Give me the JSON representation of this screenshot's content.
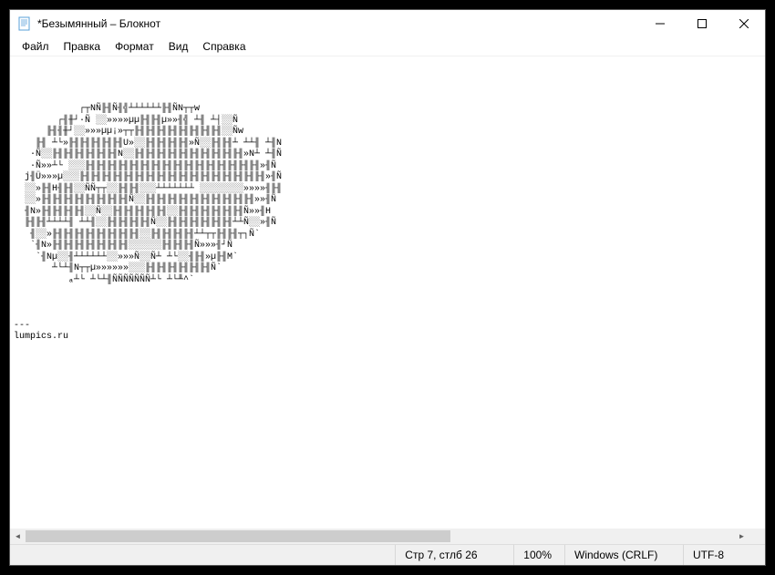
{
  "window": {
    "title": "*Безымянный – Блокнот"
  },
  "menu": {
    "file": "Файл",
    "edit": "Правка",
    "format": "Формат",
    "view": "Вид",
    "help": "Справка"
  },
  "content": {
    "text": "\n\n\n\n            ┌┬NÑ╟╢Ñ╢╣┴┴┴┴┴┴╟╢ÑN┬┬w\n        ┌╢╫┘·Ñ ░░»»»»µµ╟╢╟╢µ»»╢╣ ┴╢ ┴┤░░Ñ\n      ╟╢╢╫┘░░»»»µµ¡»┬┬╟╢╟╢╟╢╟╢╟╢╟╢╟╢╟╢░░Ñw\n    ╟╢ ┴└»╟╢╟╢╟╢╟╢╟╢U»░░╟╢╟╢╟╢╟╢»Ñ░░╟╢╟╢┴ ┴┴╢ ┴╢N\n   ·Ñ░░╟╢╟╢╟╢╟╢╟╢╟╢N░░╟╢╟╢╟╢╟╢╟╢╟╢╟╢╟╢╟╢╟╢»N┴ ┴╢Ñ\n   ·Ñ»»┴└ ░░░╟╢╟╢╟╢╟╢╟╢╟╢╟╢╟╢╟╢╟╢╟╢╟╢╟╢╟╢╟╢╟╢»╢Ñ\n  j╢Ü»»»µ░░░╟╢╟╢╟╢╟╢╟╢╟╢╟╢╟╢╟╢╟╢╟╢╟╢╟╢╟╢╟╢╟╢╟╢»╢Ñ\n  ░░»╟╢Н╢╟╢░░ÑÑ┬┬░░╟╢╟╢░░░┴┴┴┴┴┴┴ ░░░░░░░░»»»»╢╟╢\n  ░░»╟╢╟╢╟╢╟╢╟╢╟╢╟╢╟╢Ñ░░╟╢╟╢╟╢╟╢╟╢╟╢╟╢╟╢╟╢╟╢»»╢Ñ\n  ╢N»╟╢╟╢╟╢╟╢░░Ñ░░╟╢╟╢╟╢╟╢╟╢░░╟╢╟╢╟╢╟╢╟╢╟╢Ñ»»╢H\n  ╟╢╟╢┴┴┴┴╢ ┴┴╢░░╟╢╟╢╟╢╟╢Ñ░░╟╢╟╢╟╢╟╢╟╢╟╢┴┴Ñ░░»╢Ñ\n   ╢░░»╟╢╟╢╟╢╟╢╟╢╟╢╟╢╟╢░░╟╢╟╢╟╢╟╢┴┴┬┬╟╢╟╢┬┐Ñ`\n   `╢N»╟╢╟╢╟╢╟╢╟╢╟╢╟╢░░░░░░╟╢╟╢╟╢Ñ»»»╢┘Ñ\n    `╢Nµ░░╢┴┴┴┴┴┴░░»»»Ñ░░Ñ┴ ┴└░░╢╟╢»µ╟╢M`\n       ┴└┴╢N┬┬µ»»»»»»░░░╟╢╟╢╟╢╟╢╟╢╟╢Ñ`\n          ₐ┴└ ┴└┴╢ÑÑÑÑÑÑÑ┴└ ┴└╨^`\n\n\n\n---\nlumpics.ru"
  },
  "status": {
    "position": "Стр 7, стлб 26",
    "zoom": "100%",
    "line_ending": "Windows (CRLF)",
    "encoding": "UTF-8"
  }
}
